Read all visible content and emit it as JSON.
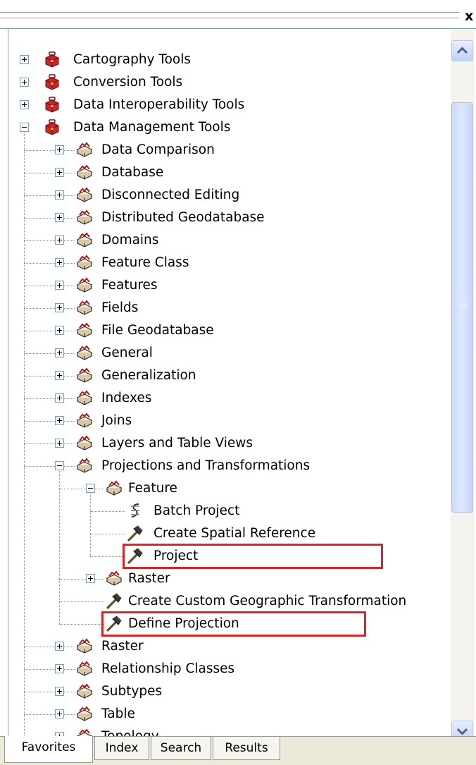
{
  "window": {
    "close_glyph": "x"
  },
  "tree": {
    "items": [
      {
        "label": "Cartography Tools",
        "level": 0,
        "expander": "plus",
        "icon": "toolbox-red-icon",
        "name": "cartography-tools"
      },
      {
        "label": "Conversion Tools",
        "level": 0,
        "expander": "plus",
        "icon": "toolbox-red-icon",
        "name": "conversion-tools"
      },
      {
        "label": "Data Interoperability Tools",
        "level": 0,
        "expander": "plus",
        "icon": "toolbox-red-icon",
        "name": "data-interoperability-tools"
      },
      {
        "label": "Data Management Tools",
        "level": 0,
        "expander": "minus",
        "icon": "toolbox-red-icon",
        "name": "data-management-tools"
      },
      {
        "label": "Data Comparison",
        "level": 1,
        "expander": "plus",
        "icon": "toolset-icon",
        "name": "data-comparison"
      },
      {
        "label": "Database",
        "level": 1,
        "expander": "plus",
        "icon": "toolset-icon",
        "name": "database"
      },
      {
        "label": "Disconnected Editing",
        "level": 1,
        "expander": "plus",
        "icon": "toolset-icon",
        "name": "disconnected-editing"
      },
      {
        "label": "Distributed Geodatabase",
        "level": 1,
        "expander": "plus",
        "icon": "toolset-icon",
        "name": "distributed-geodatabase"
      },
      {
        "label": "Domains",
        "level": 1,
        "expander": "plus",
        "icon": "toolset-icon",
        "name": "domains"
      },
      {
        "label": "Feature Class",
        "level": 1,
        "expander": "plus",
        "icon": "toolset-icon",
        "name": "feature-class"
      },
      {
        "label": "Features",
        "level": 1,
        "expander": "plus",
        "icon": "toolset-icon",
        "name": "features"
      },
      {
        "label": "Fields",
        "level": 1,
        "expander": "plus",
        "icon": "toolset-icon",
        "name": "fields"
      },
      {
        "label": "File Geodatabase",
        "level": 1,
        "expander": "plus",
        "icon": "toolset-icon",
        "name": "file-geodatabase"
      },
      {
        "label": "General",
        "level": 1,
        "expander": "plus",
        "icon": "toolset-icon",
        "name": "general"
      },
      {
        "label": "Generalization",
        "level": 1,
        "expander": "plus",
        "icon": "toolset-icon",
        "name": "generalization"
      },
      {
        "label": "Indexes",
        "level": 1,
        "expander": "plus",
        "icon": "toolset-icon",
        "name": "indexes"
      },
      {
        "label": "Joins",
        "level": 1,
        "expander": "plus",
        "icon": "toolset-icon",
        "name": "joins"
      },
      {
        "label": "Layers and Table Views",
        "level": 1,
        "expander": "plus",
        "icon": "toolset-icon",
        "name": "layers-and-table-views"
      },
      {
        "label": "Projections and Transformations",
        "level": 1,
        "expander": "minus",
        "icon": "toolset-icon",
        "name": "projections-and-transformations"
      },
      {
        "label": "Feature",
        "level": 2,
        "expander": "minus",
        "icon": "toolset-icon",
        "name": "feature"
      },
      {
        "label": "Batch Project",
        "level": 3,
        "expander": "none",
        "icon": "script-tool-icon",
        "name": "batch-project"
      },
      {
        "label": "Create Spatial Reference",
        "level": 3,
        "expander": "none",
        "icon": "hammer-icon",
        "name": "create-spatial-reference"
      },
      {
        "label": "Project",
        "level": 3,
        "expander": "none",
        "icon": "hammer-icon",
        "name": "project",
        "highlighted": true
      },
      {
        "label": "Raster",
        "level": 2,
        "expander": "plus",
        "icon": "toolset-icon",
        "name": "raster-sub"
      },
      {
        "label": "Create Custom Geographic Transformation",
        "level": 2,
        "expander": "none",
        "icon": "hammer-icon",
        "name": "create-custom-geographic-transformation"
      },
      {
        "label": "Define Projection",
        "level": 2,
        "expander": "none",
        "icon": "hammer-icon",
        "name": "define-projection",
        "highlighted": true
      },
      {
        "label": "Raster",
        "level": 1,
        "expander": "plus",
        "icon": "toolset-icon",
        "name": "raster"
      },
      {
        "label": "Relationship Classes",
        "level": 1,
        "expander": "plus",
        "icon": "toolset-icon",
        "name": "relationship-classes"
      },
      {
        "label": "Subtypes",
        "level": 1,
        "expander": "plus",
        "icon": "toolset-icon",
        "name": "subtypes"
      },
      {
        "label": "Table",
        "level": 1,
        "expander": "plus",
        "icon": "toolset-icon",
        "name": "table"
      },
      {
        "label": "Topology",
        "level": 1,
        "expander": "plus",
        "icon": "toolset-icon",
        "name": "topology"
      }
    ]
  },
  "tabs": [
    {
      "label": "Favorites",
      "active": true
    },
    {
      "label": "Index",
      "active": false
    },
    {
      "label": "Search",
      "active": false
    },
    {
      "label": "Results",
      "active": false
    }
  ],
  "colors": {
    "highlight": "#d7262a",
    "toolbox_red": "#c8262a",
    "tree_border": "#7f9db9",
    "scroll_thumb": "#c9d8fb"
  }
}
